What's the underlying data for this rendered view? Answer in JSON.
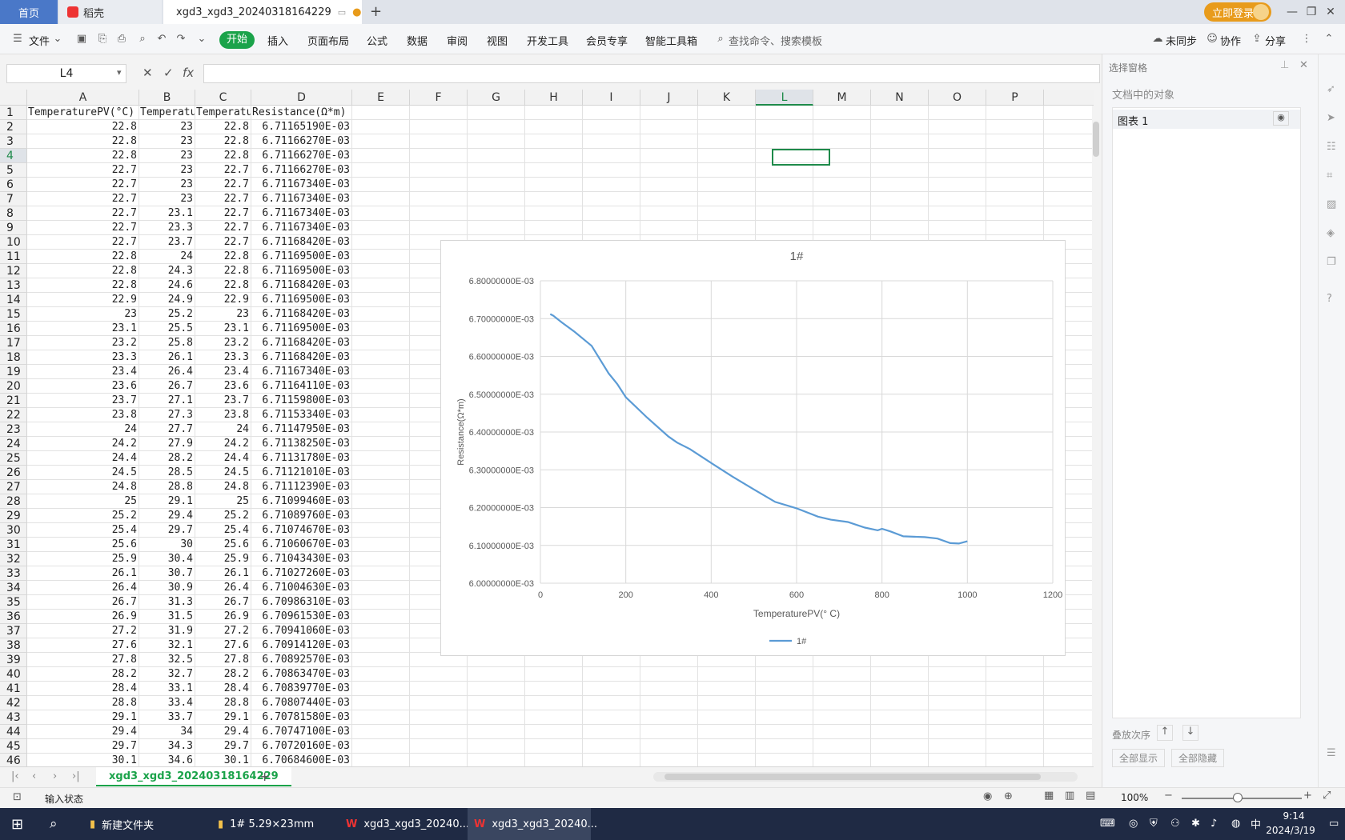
{
  "tabs": {
    "home": "首页",
    "daoke": "稻壳",
    "doc": "xgd3_xgd3_20240318164229"
  },
  "login": "立即登录",
  "menu": {
    "file": "文件",
    "start": "开始",
    "items": [
      "插入",
      "页面布局",
      "公式",
      "数据",
      "审阅",
      "视图",
      "开发工具",
      "会员专享",
      "智能工具箱"
    ],
    "search": "查找命令、搜索模板",
    "sync": "未同步",
    "collab": "协作",
    "share": "分享"
  },
  "formula": {
    "namebox": "L4",
    "fx": "fx",
    "value": ""
  },
  "columns": [
    "A",
    "B",
    "C",
    "D",
    "E",
    "F",
    "G",
    "H",
    "I",
    "J",
    "K",
    "L",
    "M",
    "N",
    "O",
    "P"
  ],
  "selected_col": "L",
  "selected_row": "4",
  "headers": [
    "TemperaturePV(°C)",
    "Temperatu",
    "Temperatu",
    "Resistance(Ω*m)"
  ],
  "rows": [
    [
      "22.8",
      "23",
      "22.8",
      "6.71165190E-03"
    ],
    [
      "22.8",
      "23",
      "22.8",
      "6.71166270E-03"
    ],
    [
      "22.8",
      "23",
      "22.8",
      "6.71166270E-03"
    ],
    [
      "22.7",
      "23",
      "22.7",
      "6.71166270E-03"
    ],
    [
      "22.7",
      "23",
      "22.7",
      "6.71167340E-03"
    ],
    [
      "22.7",
      "23",
      "22.7",
      "6.71167340E-03"
    ],
    [
      "22.7",
      "23.1",
      "22.7",
      "6.71167340E-03"
    ],
    [
      "22.7",
      "23.3",
      "22.7",
      "6.71167340E-03"
    ],
    [
      "22.7",
      "23.7",
      "22.7",
      "6.71168420E-03"
    ],
    [
      "22.8",
      "24",
      "22.8",
      "6.71169500E-03"
    ],
    [
      "22.8",
      "24.3",
      "22.8",
      "6.71169500E-03"
    ],
    [
      "22.8",
      "24.6",
      "22.8",
      "6.71168420E-03"
    ],
    [
      "22.9",
      "24.9",
      "22.9",
      "6.71169500E-03"
    ],
    [
      "23",
      "25.2",
      "23",
      "6.71168420E-03"
    ],
    [
      "23.1",
      "25.5",
      "23.1",
      "6.71169500E-03"
    ],
    [
      "23.2",
      "25.8",
      "23.2",
      "6.71168420E-03"
    ],
    [
      "23.3",
      "26.1",
      "23.3",
      "6.71168420E-03"
    ],
    [
      "23.4",
      "26.4",
      "23.4",
      "6.71167340E-03"
    ],
    [
      "23.6",
      "26.7",
      "23.6",
      "6.71164110E-03"
    ],
    [
      "23.7",
      "27.1",
      "23.7",
      "6.71159800E-03"
    ],
    [
      "23.8",
      "27.3",
      "23.8",
      "6.71153340E-03"
    ],
    [
      "24",
      "27.7",
      "24",
      "6.71147950E-03"
    ],
    [
      "24.2",
      "27.9",
      "24.2",
      "6.71138250E-03"
    ],
    [
      "24.4",
      "28.2",
      "24.4",
      "6.71131780E-03"
    ],
    [
      "24.5",
      "28.5",
      "24.5",
      "6.71121010E-03"
    ],
    [
      "24.8",
      "28.8",
      "24.8",
      "6.71112390E-03"
    ],
    [
      "25",
      "29.1",
      "25",
      "6.71099460E-03"
    ],
    [
      "25.2",
      "29.4",
      "25.2",
      "6.71089760E-03"
    ],
    [
      "25.4",
      "29.7",
      "25.4",
      "6.71074670E-03"
    ],
    [
      "25.6",
      "30",
      "25.6",
      "6.71060670E-03"
    ],
    [
      "25.9",
      "30.4",
      "25.9",
      "6.71043430E-03"
    ],
    [
      "26.1",
      "30.7",
      "26.1",
      "6.71027260E-03"
    ],
    [
      "26.4",
      "30.9",
      "26.4",
      "6.71004630E-03"
    ],
    [
      "26.7",
      "31.3",
      "26.7",
      "6.70986310E-03"
    ],
    [
      "26.9",
      "31.5",
      "26.9",
      "6.70961530E-03"
    ],
    [
      "27.2",
      "31.9",
      "27.2",
      "6.70941060E-03"
    ],
    [
      "27.6",
      "32.1",
      "27.6",
      "6.70914120E-03"
    ],
    [
      "27.8",
      "32.5",
      "27.8",
      "6.70892570E-03"
    ],
    [
      "28.2",
      "32.7",
      "28.2",
      "6.70863470E-03"
    ],
    [
      "28.4",
      "33.1",
      "28.4",
      "6.70839770E-03"
    ],
    [
      "28.8",
      "33.4",
      "28.8",
      "6.70807440E-03"
    ],
    [
      "29.1",
      "33.7",
      "29.1",
      "6.70781580E-03"
    ],
    [
      "29.4",
      "34",
      "29.4",
      "6.70747100E-03"
    ],
    [
      "29.7",
      "34.3",
      "29.7",
      "6.70720160E-03"
    ],
    [
      "30.1",
      "34.6",
      "30.1",
      "6.70684600E-03"
    ]
  ],
  "chart_data": {
    "type": "line",
    "title": "1#",
    "xlabel": "TemperaturePV(° C)",
    "ylabel": "Resistance(Ω*m)",
    "xlim": [
      0,
      1200
    ],
    "ylim": [
      0.006,
      0.0068
    ],
    "xticks": [
      "0",
      "200",
      "400",
      "600",
      "800",
      "1000",
      "1200"
    ],
    "yticks": [
      "6.00000000E-03",
      "6.10000000E-03",
      "6.20000000E-03",
      "6.30000000E-03",
      "6.40000000E-03",
      "6.50000000E-03",
      "6.60000000E-03",
      "6.70000000E-03",
      "6.80000000E-03"
    ],
    "grid": true,
    "legend": "bottom",
    "color": "#5b9bd5",
    "series": [
      {
        "name": "1#",
        "x": [
          23,
          30,
          50,
          80,
          120,
          160,
          180,
          200,
          250,
          300,
          320,
          350,
          400,
          450,
          500,
          550,
          600,
          650,
          680,
          720,
          760,
          790,
          800,
          820,
          850,
          900,
          930,
          960,
          980,
          1000
        ],
        "y": [
          0.006712,
          0.006708,
          0.00669,
          0.006665,
          0.006628,
          0.006555,
          0.006527,
          0.006492,
          0.006438,
          0.006388,
          0.006372,
          0.006355,
          0.006318,
          0.006282,
          0.006248,
          0.006215,
          0.006198,
          0.006176,
          0.006168,
          0.006162,
          0.006147,
          0.00614,
          0.006144,
          0.006137,
          0.006124,
          0.006122,
          0.006118,
          0.006106,
          0.006105,
          0.006111
        ]
      }
    ]
  },
  "sheet": {
    "name": "xgd3_xgd3_20240318164229"
  },
  "panel": {
    "title": "选择窗格",
    "subtitle": "文档中的对象",
    "object": "图表 1",
    "order": "叠放次序",
    "show_all": "全部显示",
    "hide_all": "全部隐藏"
  },
  "status": {
    "mode": "输入状态",
    "zoom": "100%"
  },
  "taskbar": {
    "items": [
      "新建文件夹",
      "1# 5.29×23mm",
      "xgd3_xgd3_20240...",
      "xgd3_xgd3_20240..."
    ],
    "time": "9:14",
    "date": "2024/3/19"
  }
}
